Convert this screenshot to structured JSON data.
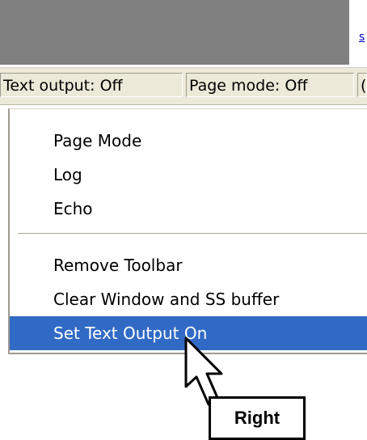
{
  "link": {
    "text": "s"
  },
  "status_bar": {
    "text_output": "Text output: Off",
    "page_mode": "Page mode: Off",
    "partial": "("
  },
  "context_menu": {
    "items": [
      {
        "label": "Page Mode"
      },
      {
        "label": "Log"
      },
      {
        "label": "Echo"
      },
      {
        "label": "Remove Toolbar"
      },
      {
        "label": "Clear Window and SS buffer"
      },
      {
        "label": "Set Text Output On",
        "highlighted": true
      }
    ]
  },
  "annotation": {
    "label": "Right"
  },
  "icons": {
    "cursor": "arrow-cursor-icon"
  },
  "colors": {
    "highlight": "#316ac5",
    "window_bg": "#808080",
    "status_bg": "#ece9d8"
  }
}
